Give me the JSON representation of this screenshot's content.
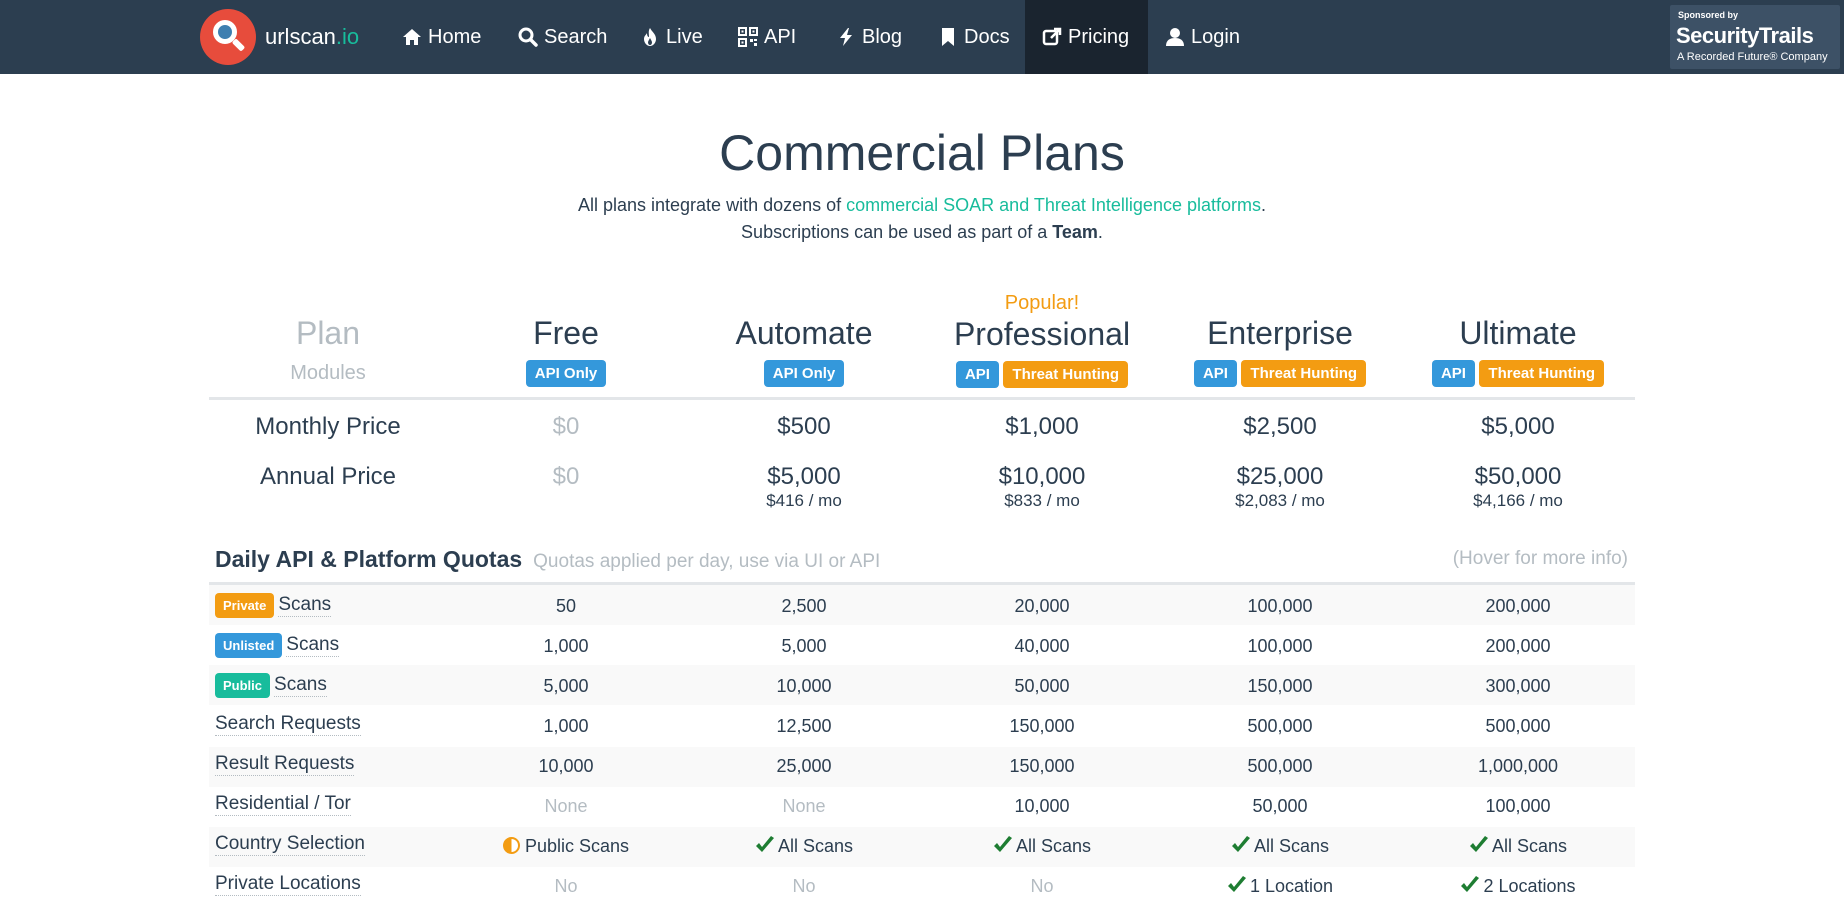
{
  "nav": {
    "brand_name": "urlscan",
    "brand_tld": ".io",
    "items": [
      {
        "label": "Home",
        "icon": "home-icon"
      },
      {
        "label": "Search",
        "icon": "search-icon"
      },
      {
        "label": "Live",
        "icon": "fire-icon"
      },
      {
        "label": "API",
        "icon": "qrcode-icon"
      },
      {
        "label": "Blog",
        "icon": "bolt-icon"
      },
      {
        "label": "Docs",
        "icon": "bookmark-icon"
      },
      {
        "label": "Pricing",
        "icon": "external-link-icon",
        "active": true
      },
      {
        "label": "Login",
        "icon": "user-icon"
      }
    ],
    "sponsor": {
      "line1": "Sponsored by",
      "line2": "SecurityTrails",
      "line3": "A Recorded Future® Company"
    }
  },
  "header": {
    "title": "Commercial Plans",
    "lead1_pre": "All plans integrate with dozens of ",
    "lead1_link": "commercial SOAR and Threat Intelligence platforms",
    "lead1_post": ".",
    "lead2_pre": "Subscriptions can be used as part of a ",
    "lead2_bold": "Team",
    "lead2_post": "."
  },
  "plans": {
    "label_plan": "Plan",
    "label_modules": "Modules",
    "popular": "Popular!",
    "columns": [
      {
        "name": "Free",
        "modules": [
          "API Only"
        ],
        "monthly": "$0",
        "annual": "$0",
        "annual_mo": ""
      },
      {
        "name": "Automate",
        "modules": [
          "API Only"
        ],
        "monthly": "$500",
        "annual": "$5,000",
        "annual_mo": "$416 / mo"
      },
      {
        "name": "Professional",
        "modules": [
          "API",
          "Threat Hunting"
        ],
        "monthly": "$1,000",
        "annual": "$10,000",
        "annual_mo": "$833 / mo"
      },
      {
        "name": "Enterprise",
        "modules": [
          "API",
          "Threat Hunting"
        ],
        "monthly": "$2,500",
        "annual": "$25,000",
        "annual_mo": "$2,083 / mo"
      },
      {
        "name": "Ultimate",
        "modules": [
          "API",
          "Threat Hunting"
        ],
        "monthly": "$5,000",
        "annual": "$50,000",
        "annual_mo": "$4,166 / mo"
      }
    ],
    "monthly_label": "Monthly Price",
    "annual_label": "Annual Price"
  },
  "quotas": {
    "heading": "Daily API & Platform Quotas",
    "subheading": "Quotas applied per day, use via UI or API",
    "hover": "(Hover for more info)",
    "rows": [
      {
        "badge": "Private",
        "badge_color": "#f39c12",
        "label": "Scans",
        "values": [
          "50",
          "2,500",
          "20,000",
          "100,000",
          "200,000"
        ]
      },
      {
        "badge": "Unlisted",
        "badge_color": "#3498db",
        "label": "Scans",
        "values": [
          "1,000",
          "5,000",
          "40,000",
          "100,000",
          "200,000"
        ]
      },
      {
        "badge": "Public",
        "badge_color": "#18bc9c",
        "label": "Scans",
        "values": [
          "5,000",
          "10,000",
          "50,000",
          "150,000",
          "300,000"
        ]
      },
      {
        "badge": "",
        "label": "Search Requests",
        "values": [
          "1,000",
          "12,500",
          "150,000",
          "500,000",
          "500,000"
        ]
      },
      {
        "badge": "",
        "label": "Result Requests",
        "values": [
          "10,000",
          "25,000",
          "150,000",
          "500,000",
          "1,000,000"
        ]
      },
      {
        "badge": "",
        "label": "Residential / Tor",
        "values": [
          "None",
          "None",
          "10,000",
          "50,000",
          "100,000"
        ]
      },
      {
        "badge": "",
        "label": "Country Selection",
        "values": [
          "Public Scans",
          "All Scans",
          "All Scans",
          "All Scans",
          "All Scans"
        ]
      },
      {
        "badge": "",
        "label": "Private Locations",
        "values": [
          "No",
          "No",
          "No",
          "1 Location",
          "2 Locations"
        ]
      }
    ]
  }
}
